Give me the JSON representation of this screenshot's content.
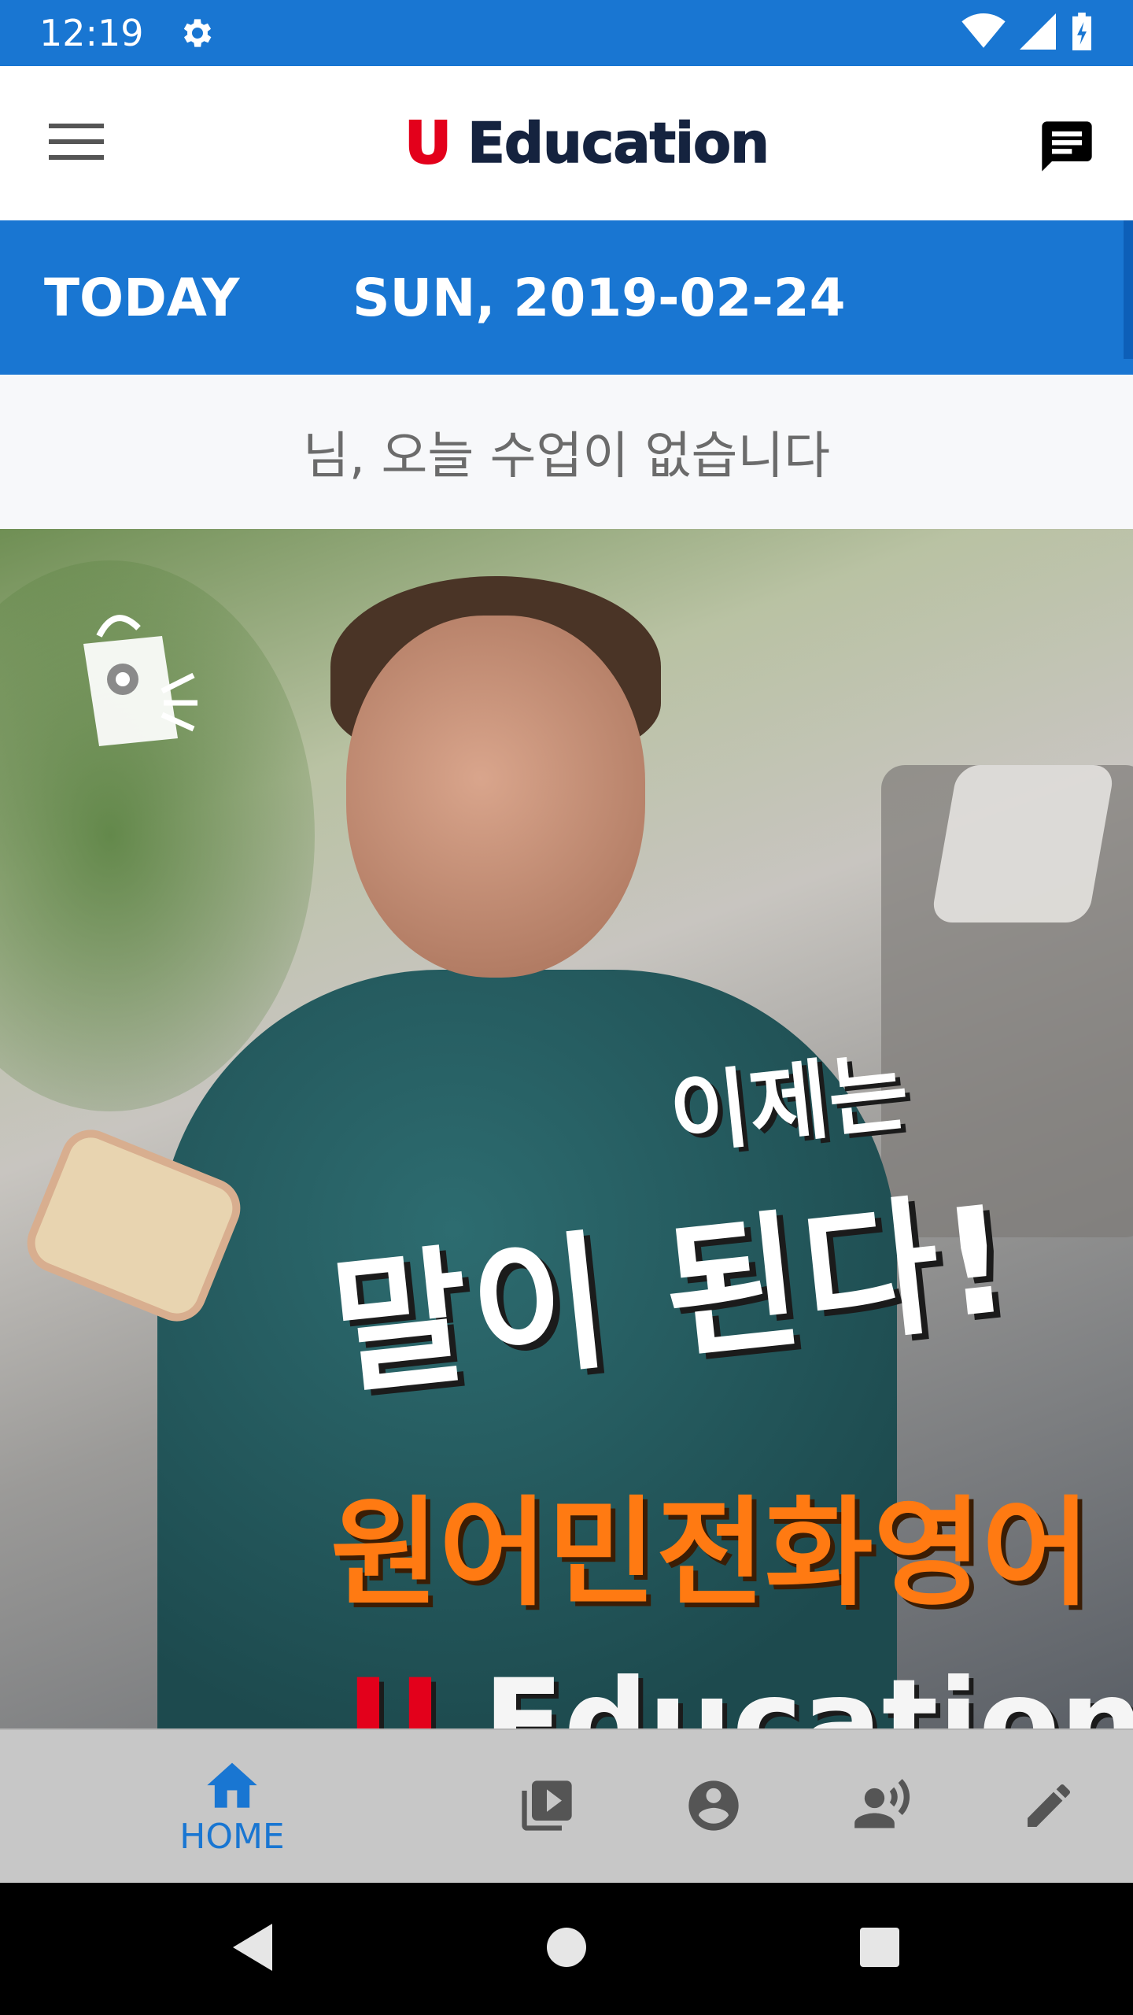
{
  "status_bar": {
    "time": "12:19",
    "icons": [
      "gear-icon",
      "wifi-icon",
      "signal-icon",
      "battery-icon"
    ],
    "background": "#1976d2"
  },
  "app_bar": {
    "logo_u": "U",
    "logo_text": "Education",
    "menu_icon": "hamburger-menu-icon",
    "chat_icon": "chat-message-icon"
  },
  "date_bar": {
    "label": "TODAY",
    "date": "SUN, 2019-02-24"
  },
  "message": {
    "text": "님, 오늘 수업이 없습니다"
  },
  "banner": {
    "line1": "이제는",
    "line2": "말이 된다!",
    "line3": "원어민전화영어",
    "brand_u": "U",
    "brand_text": "Education",
    "logo_icon": "shopping-bag-speaker-icon"
  },
  "bottom_nav": {
    "items": [
      {
        "icon": "home-icon",
        "label": "HOME",
        "active": true
      },
      {
        "icon": "video-library-icon",
        "label": ""
      },
      {
        "icon": "account-circle-icon",
        "label": ""
      },
      {
        "icon": "record-voice-icon",
        "label": ""
      },
      {
        "icon": "edit-pencil-icon",
        "label": ""
      }
    ],
    "active_color": "#1976d2",
    "inactive_color": "#555555"
  },
  "system_nav": {
    "buttons": [
      "back-icon",
      "home-circle-icon",
      "recents-icon"
    ]
  }
}
